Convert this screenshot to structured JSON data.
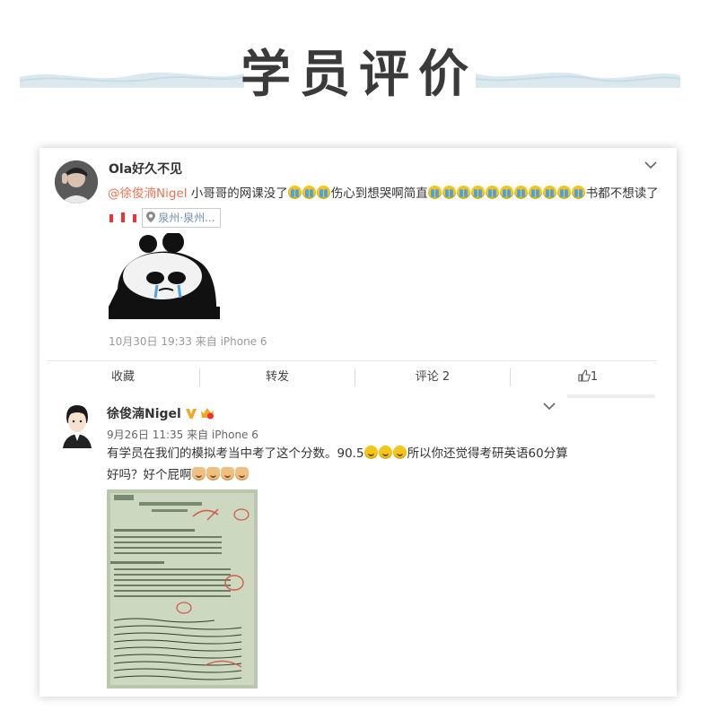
{
  "page": {
    "title": "学员评价"
  },
  "post1": {
    "username": "Ola好久不见",
    "mention": "@徐俊湳Nigel",
    "text_a": " 小哥哥的网课没了",
    "text_b": "伤心到想哭啊简直",
    "text_c": "书都不想读了",
    "cry_emoji_count_a": 3,
    "cry_emoji_count_b": 11,
    "location": "泉州·泉州...",
    "timestamp": "10月30日 19:33 来自 iPhone 6",
    "image_icon": "crying-panda-meme"
  },
  "actions": {
    "favorite": "收藏",
    "repost": "转发",
    "comment": "评论 2",
    "like_count": "1",
    "like_icon": "thumbs-up-icon"
  },
  "post2": {
    "username": "徐俊湳Nigel",
    "timestamp": "9月26日 11:35 来自 iPhone 6",
    "text_a": "有学员在我们的模拟考当中考了这个分数。90.5",
    "text_b": "所以你还觉得考研英语60分算好吗？好个屁啊",
    "smile_emoji_count": 3,
    "cat_emoji_count": 4,
    "image_icon": "graded-exam-paper-photo"
  },
  "colors": {
    "title": "#3a3a3a",
    "mention": "#eb7350",
    "location": "#6f8eb3",
    "verified": "#f5a623",
    "wave": "#c7dde6"
  }
}
